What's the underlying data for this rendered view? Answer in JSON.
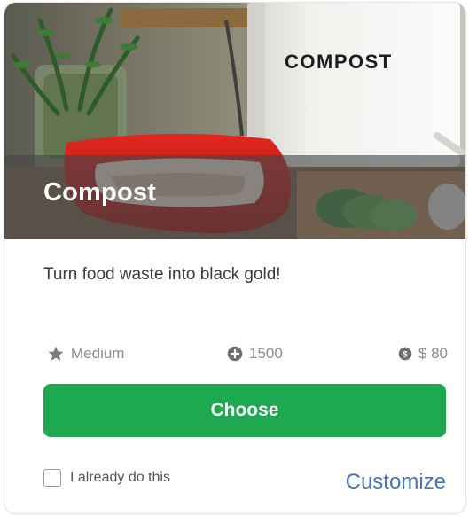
{
  "card": {
    "title": "Compost",
    "image_label": "COMPOST",
    "description": "Turn food waste into black gold!",
    "level": {
      "icon": "star-icon",
      "label": "Medium"
    },
    "points": {
      "icon": "plus-circle-icon",
      "value": "1500"
    },
    "cost": {
      "icon": "dollar-coin-icon",
      "value": "$ 80"
    },
    "choose_label": "Choose",
    "already_label": "I already do this",
    "already_checked": false,
    "customize_label": "Customize"
  },
  "colors": {
    "accent": "#1ea84f",
    "link": "#4a74b8",
    "meta_text": "#8c8c8c",
    "body_text": "#3b3b3b"
  }
}
